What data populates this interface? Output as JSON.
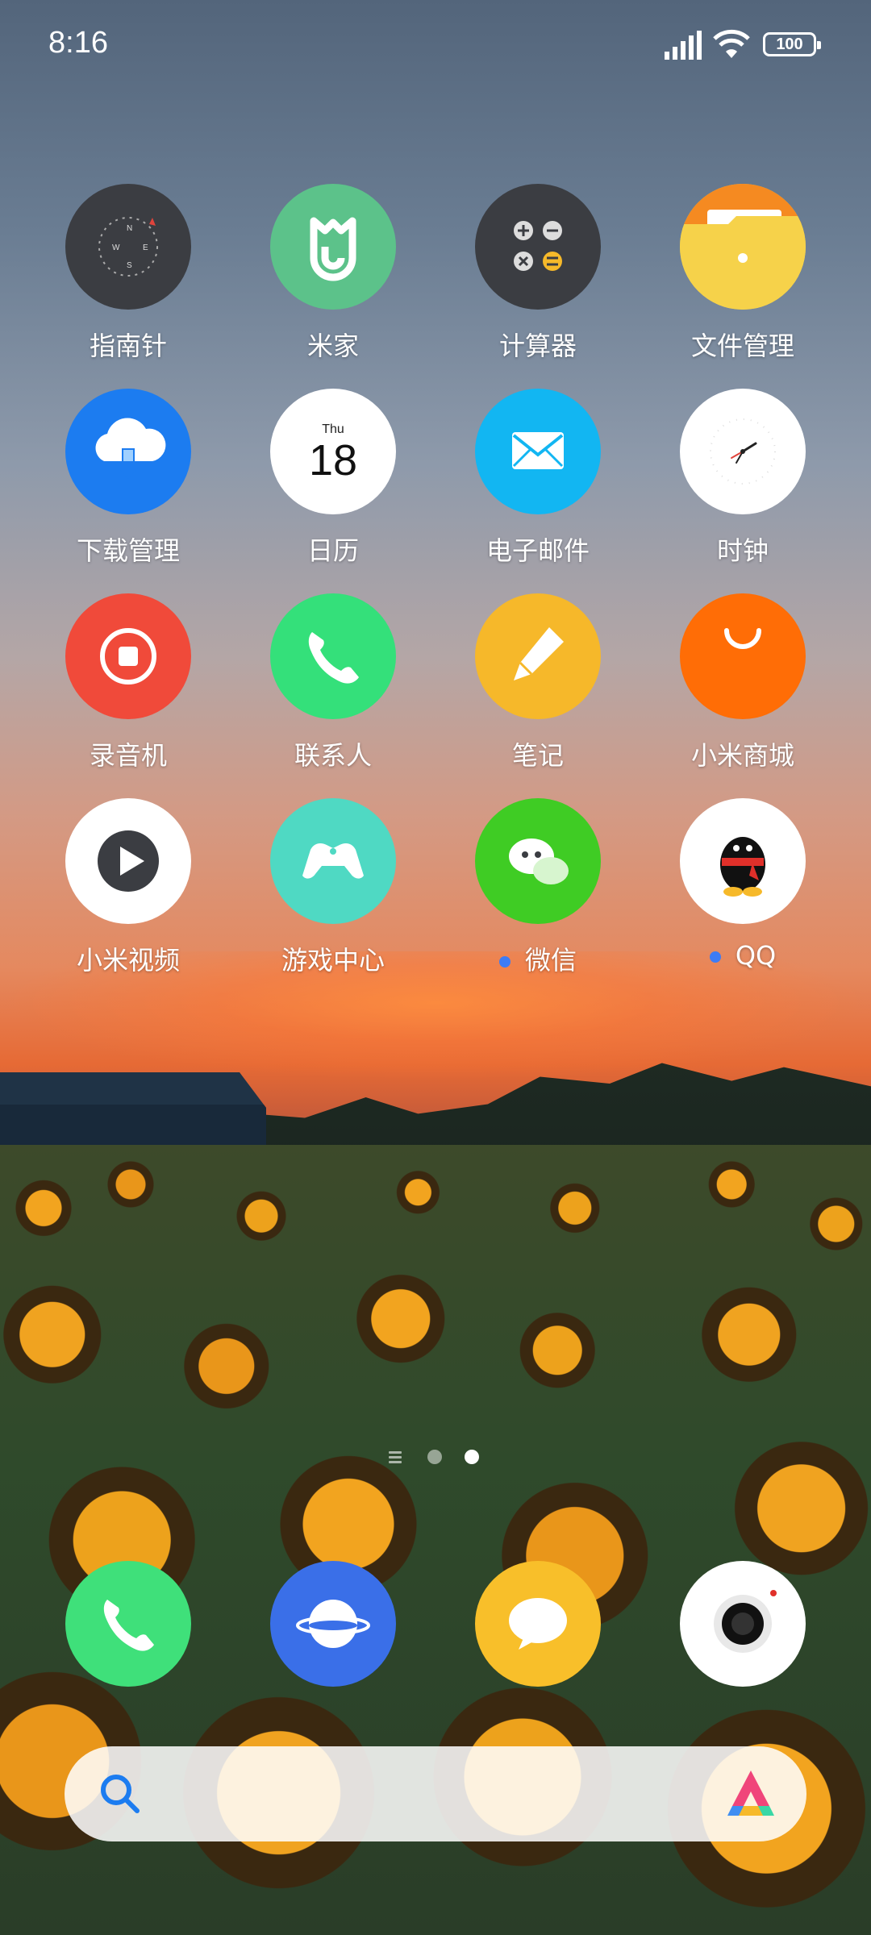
{
  "status_bar": {
    "time": "8:16",
    "battery": "100"
  },
  "apps": [
    {
      "label": "指南针",
      "icon": "compass-icon",
      "color": "#3b3d42"
    },
    {
      "label": "米家",
      "icon": "mi-home-icon",
      "color": "#5cc28a"
    },
    {
      "label": "计算器",
      "icon": "calculator-icon",
      "color": "#3b3d42"
    },
    {
      "label": "文件管理",
      "icon": "folder-icon",
      "color": "#f6d24a"
    },
    {
      "label": "下载管理",
      "icon": "download-cloud-icon",
      "color": "#1c7cf0"
    },
    {
      "label": "日历",
      "icon": "calendar-icon",
      "color": "#ffffff",
      "day_name": "Thu",
      "day_number": "18"
    },
    {
      "label": "电子邮件",
      "icon": "mail-icon",
      "color": "#12b6f2"
    },
    {
      "label": "时钟",
      "icon": "clock-icon",
      "color": "#ffffff"
    },
    {
      "label": "录音机",
      "icon": "recorder-icon",
      "color": "#f04a3a"
    },
    {
      "label": "联系人",
      "icon": "phone-icon",
      "color": "#34e07a"
    },
    {
      "label": "笔记",
      "icon": "pencil-icon",
      "color": "#f6b82a"
    },
    {
      "label": "小米商城",
      "icon": "mi-store-icon",
      "color": "#ff6d06"
    },
    {
      "label": "小米视频",
      "icon": "video-play-icon",
      "color": "#ffffff"
    },
    {
      "label": "游戏中心",
      "icon": "gamepad-icon",
      "color": "#4fd9c3"
    },
    {
      "label": "微信",
      "icon": "wechat-icon",
      "color": "#3fcc24",
      "badge": "new"
    },
    {
      "label": "QQ",
      "icon": "qq-penguin-icon",
      "color": "#ffffff",
      "badge": "new"
    }
  ],
  "pager": {
    "total_pages": 2,
    "current_page": 2
  },
  "dock": [
    {
      "icon": "phone-icon",
      "color": "#3fe07a"
    },
    {
      "icon": "browser-icon",
      "color": "#3a6fe8"
    },
    {
      "icon": "messages-icon",
      "color": "#f8bf2a"
    },
    {
      "icon": "camera-icon",
      "color": "#ffffff"
    }
  ],
  "search": {
    "icon": "search-icon",
    "assistant_icon": "assistant-logo-icon"
  }
}
